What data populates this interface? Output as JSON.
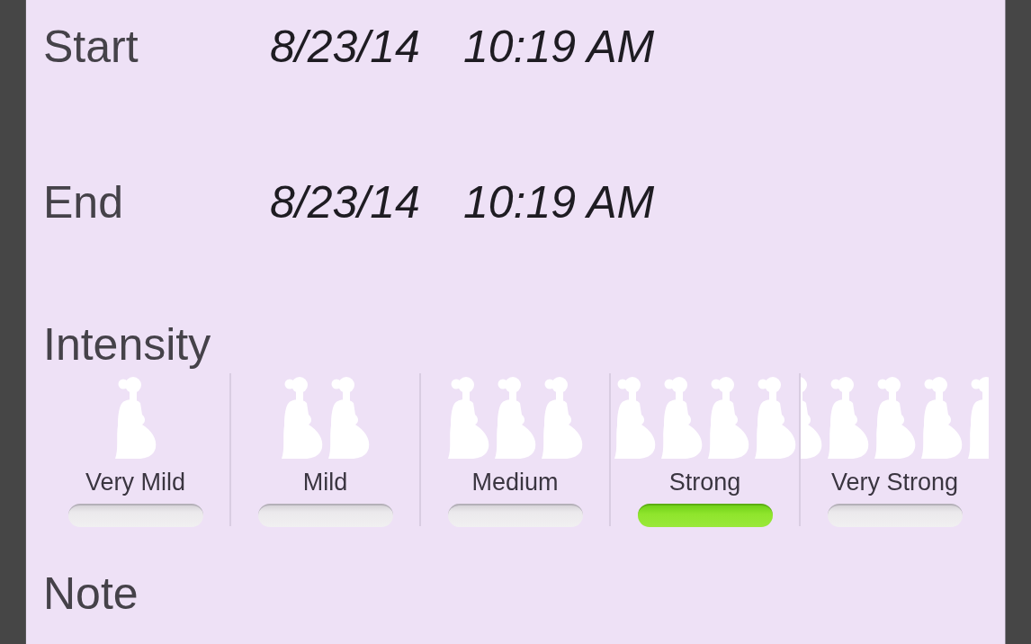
{
  "fields": [
    {
      "label": "Start",
      "date": "8/23/14",
      "time": "10:19 AM"
    },
    {
      "label": "End",
      "date": "8/23/14",
      "time": "10:19 AM"
    }
  ],
  "intensity": {
    "label": "Intensity",
    "options": [
      {
        "label": "Very Mild",
        "selected": false
      },
      {
        "label": "Mild",
        "selected": false
      },
      {
        "label": "Medium",
        "selected": false
      },
      {
        "label": "Strong",
        "selected": true
      },
      {
        "label": "Very Strong",
        "selected": false
      }
    ]
  },
  "note": {
    "label": "Note"
  }
}
